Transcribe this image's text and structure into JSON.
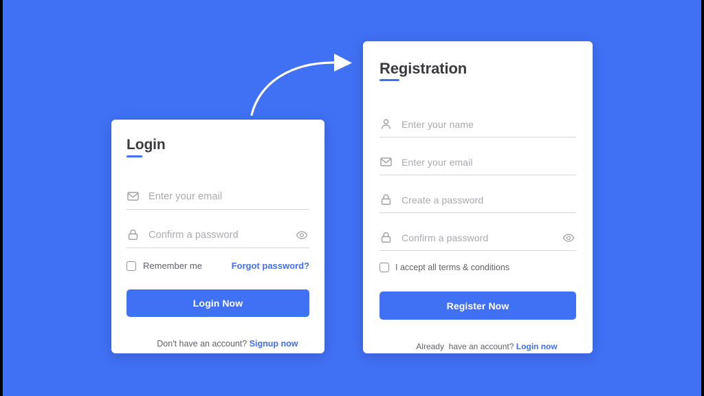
{
  "theme": {
    "background_color": "#4070f4",
    "accent_color": "#4070f4",
    "card_background": "#ffffff",
    "placeholder_color": "#a9a9ae",
    "text_color": "#5f5f66",
    "heading_color": "#3a3a3f",
    "link_color": "#4070f4",
    "arrow_color": "#ffffff"
  },
  "arrow": {
    "icon": "curved-arrow-right-icon",
    "description": "white curved arrow pointing from the login card to the registration card"
  },
  "login_card": {
    "heading": "Login",
    "fields": [
      {
        "icon": "envelope-icon",
        "placeholder": "Enter your email",
        "value": "",
        "type": "email",
        "has_toggle": false
      },
      {
        "icon": "lock-icon",
        "placeholder": "Confirm a password",
        "value": "",
        "type": "password",
        "has_toggle": true,
        "toggle_icon": "eye-icon"
      }
    ],
    "remember_me_label": "Remember me",
    "remember_me_checked": false,
    "forgot_password_label": "Forgot password?",
    "submit_label": "Login Now",
    "footer_text": "Don't have an account? ",
    "footer_link": "Signup now"
  },
  "registration_card": {
    "heading": "Registration",
    "fields": [
      {
        "icon": "person-icon",
        "placeholder": "Enter your name",
        "value": "",
        "type": "text",
        "has_toggle": false
      },
      {
        "icon": "envelope-icon",
        "placeholder": "Enter your email",
        "value": "",
        "type": "email",
        "has_toggle": false
      },
      {
        "icon": "lock-icon",
        "placeholder": "Create a password",
        "value": "",
        "type": "password",
        "has_toggle": false
      },
      {
        "icon": "lock-icon",
        "placeholder": "Confirm a password",
        "value": "",
        "type": "password",
        "has_toggle": true,
        "toggle_icon": "eye-icon"
      }
    ],
    "terms_label": "I accept all terms & conditions",
    "terms_checked": false,
    "submit_label": "Register Now",
    "footer_text": "Already  have an account? ",
    "footer_link": "Login now"
  }
}
